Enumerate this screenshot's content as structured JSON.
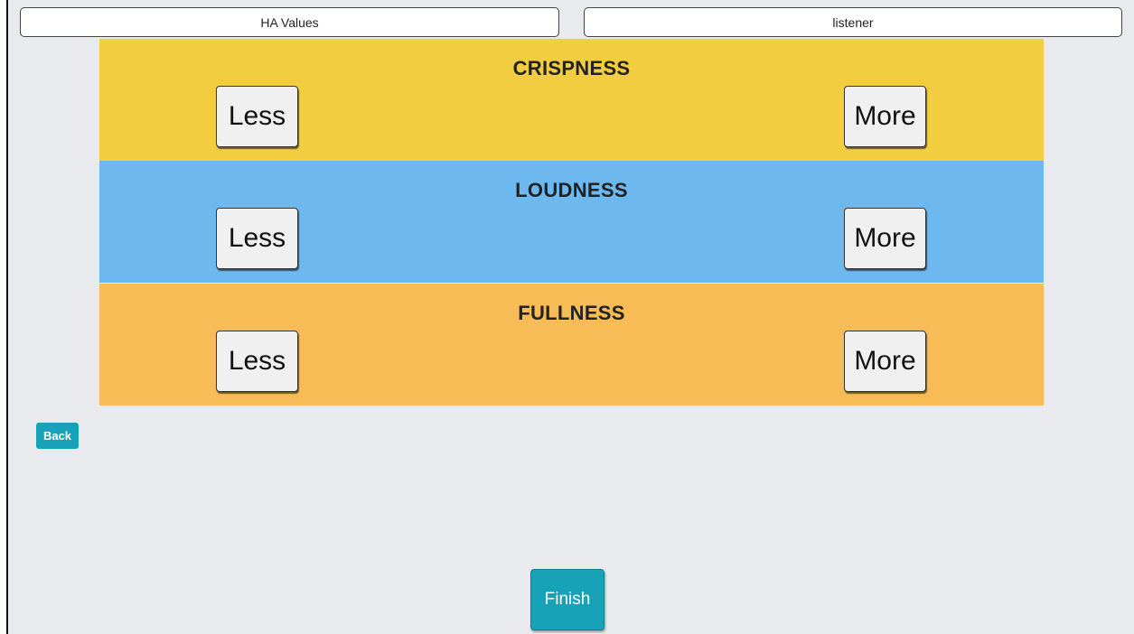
{
  "tabs": {
    "left_label": "HA Values",
    "right_label": "listener"
  },
  "panels": [
    {
      "title": "CRISPNESS",
      "less_label": "Less",
      "more_label": "More",
      "color": "#f2cd40"
    },
    {
      "title": "LOUDNESS",
      "less_label": "Less",
      "more_label": "More",
      "color": "#6cb8ef"
    },
    {
      "title": "FULLNESS",
      "less_label": "Less",
      "more_label": "More",
      "color": "#f7bc55"
    }
  ],
  "back_label": "Back",
  "finish_label": "Finish",
  "colors": {
    "background": "#e8eaed",
    "accent": "#17a2b8"
  }
}
